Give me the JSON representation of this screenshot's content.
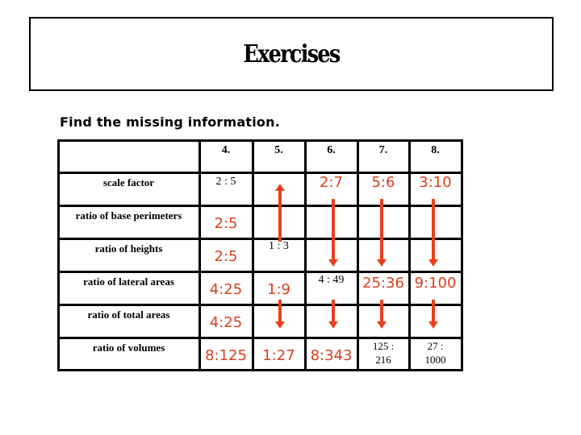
{
  "title": "Exercises",
  "instruction": "Find the missing information.",
  "table": {
    "columns": [
      "",
      "4.",
      "5.",
      "6.",
      "7.",
      "8."
    ],
    "rows": [
      {
        "label": "scale factor",
        "cells": [
          {
            "text": "2 : 5",
            "style": "given"
          },
          {
            "text": "",
            "style": "given"
          },
          {
            "text": "2:7",
            "style": "answer"
          },
          {
            "text": "5:6",
            "style": "answer"
          },
          {
            "text": "3:10",
            "style": "answer"
          }
        ]
      },
      {
        "label": "ratio of base perimeters",
        "cells": [
          {
            "text": "2:5",
            "style": "answer"
          },
          {
            "text": "",
            "style": "given"
          },
          {
            "text": "",
            "style": "given"
          },
          {
            "text": "",
            "style": "given"
          },
          {
            "text": "",
            "style": "given"
          }
        ]
      },
      {
        "label": "ratio of heights",
        "cells": [
          {
            "text": "2:5",
            "style": "answer"
          },
          {
            "text": "1 : 3",
            "style": "given"
          },
          {
            "text": "",
            "style": "given"
          },
          {
            "text": "",
            "style": "given"
          },
          {
            "text": "",
            "style": "given"
          }
        ]
      },
      {
        "label": "ratio of lateral areas",
        "cells": [
          {
            "text": "4:25",
            "style": "answer"
          },
          {
            "text": "1:9",
            "style": "answer"
          },
          {
            "text": "4 : 49",
            "style": "given"
          },
          {
            "text": "25:36",
            "style": "answer"
          },
          {
            "text": "9:100",
            "style": "answer"
          }
        ]
      },
      {
        "label": "ratio of total areas",
        "cells": [
          {
            "text": "4:25",
            "style": "answer"
          },
          {
            "text": "",
            "style": "given"
          },
          {
            "text": "",
            "style": "given"
          },
          {
            "text": "",
            "style": "given"
          },
          {
            "text": "",
            "style": "given"
          }
        ]
      },
      {
        "label": "ratio of volumes",
        "cells": [
          {
            "text": "8:125",
            "style": "answer"
          },
          {
            "text": "1:27",
            "style": "answer"
          },
          {
            "text": "8:343",
            "style": "answer"
          },
          {
            "text": "125 : 216",
            "style": "given"
          },
          {
            "text": "27 : 1000",
            "style": "given"
          }
        ]
      }
    ]
  },
  "arrows": [
    {
      "column": "5.",
      "direction": "up",
      "from_row": "ratio of heights",
      "to_row": "scale factor"
    },
    {
      "column": "6.",
      "direction": "down",
      "from_row": "scale factor",
      "to_row": "ratio of heights"
    },
    {
      "column": "7.",
      "direction": "down",
      "from_row": "scale factor",
      "to_row": "ratio of heights"
    },
    {
      "column": "8.",
      "direction": "down",
      "from_row": "scale factor",
      "to_row": "ratio of heights"
    },
    {
      "column": "5.",
      "direction": "down",
      "from_row": "ratio of lateral areas",
      "to_row": "ratio of volumes"
    },
    {
      "column": "6.",
      "direction": "down",
      "from_row": "ratio of lateral areas",
      "to_row": "ratio of volumes"
    },
    {
      "column": "7.",
      "direction": "down",
      "from_row": "ratio of lateral areas",
      "to_row": "ratio of volumes"
    },
    {
      "column": "8.",
      "direction": "down",
      "from_row": "ratio of lateral areas",
      "to_row": "ratio of volumes"
    }
  ],
  "colors": {
    "answer": "#D8401C",
    "arrow": "#E8401A",
    "text": "#000000"
  }
}
